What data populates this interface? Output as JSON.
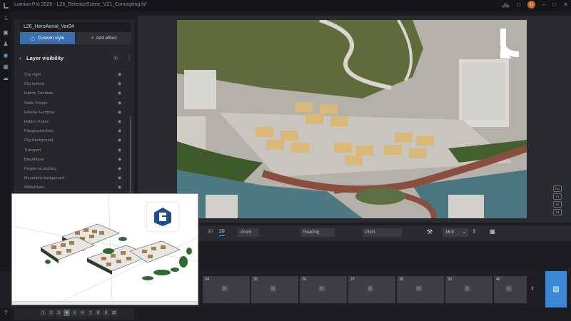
{
  "window": {
    "title": "Lumion Pro 2026 - L26_ReleaseScene_V21_Concepting.lsf",
    "user_initial": "U"
  },
  "left_toolbar": {
    "icons": [
      "lumion-logo-icon",
      "build-icon",
      "people-icon",
      "camera-icon",
      "movie-icon",
      "cloud-icon"
    ]
  },
  "effects_panel": {
    "scene_name": "L26_HeroAerial_Var04",
    "custom_style_label": "Custom style",
    "add_effect_label": "Add effect",
    "layer_visibility_title": "Layer visibility",
    "layers": [
      "City night",
      "City behind",
      "Interior Furniture",
      "Static People",
      "Exterior Furniture",
      "Hidden Palms",
      "Playground Area",
      "City Background",
      "Transport",
      "BlackPlane",
      "People on building",
      "Mountains background",
      "WhitePlane"
    ]
  },
  "camera_controls": {
    "mode_3d": "3D",
    "mode_2d": "2D",
    "zoom_label": "Zoom",
    "heading_label": "Heading",
    "pitch_label": "Pitch",
    "aspect_ratio": "16:9"
  },
  "viewport_buttons": [
    "F11",
    "F1",
    "F2",
    "F3"
  ],
  "thumbnails": [
    "34",
    "35",
    "36",
    "37",
    "38",
    "39",
    "40"
  ],
  "pagination": {
    "pages": [
      "1",
      "2",
      "3",
      "4",
      "5",
      "6",
      "7",
      "8",
      "9",
      "10"
    ],
    "active_page": "4"
  },
  "colors": {
    "accent_blue": "#3d88d6",
    "custom_style_button": "#3c6fb0",
    "panel_bg": "#26272c",
    "app_bg": "#1c1d21"
  }
}
